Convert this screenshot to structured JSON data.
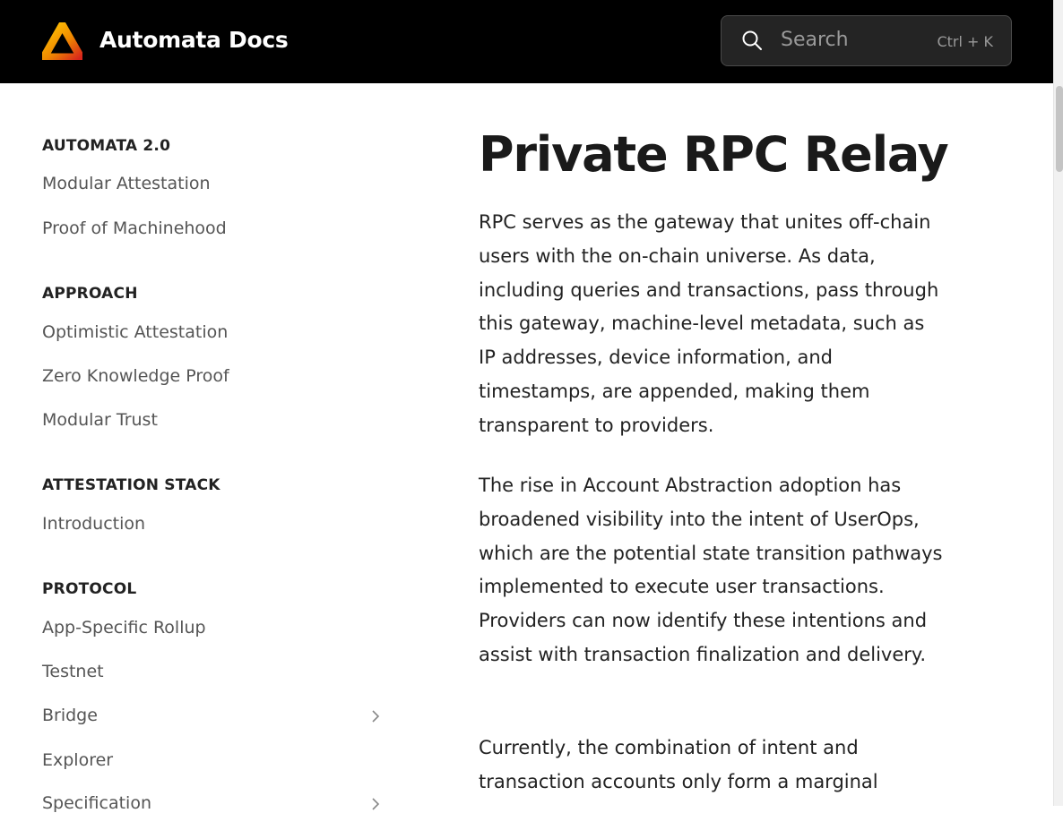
{
  "header": {
    "brand": "Automata Docs",
    "search_placeholder": "Search",
    "search_shortcut": "Ctrl + K"
  },
  "sidebar": {
    "sections": [
      {
        "title": "AUTOMATA 2.0",
        "items": [
          "Modular Attestation",
          "Proof of Machinehood"
        ]
      },
      {
        "title": "APPROACH",
        "items": [
          "Optimistic Attestation",
          "Zero Knowledge Proof",
          "Modular Trust"
        ]
      },
      {
        "title": "ATTESTATION STACK",
        "items": [
          "Introduction"
        ]
      },
      {
        "title": "PROTOCOL",
        "items": [
          "App-Specific Rollup",
          "Testnet",
          "Bridge",
          "Explorer",
          "Specification"
        ]
      }
    ]
  },
  "main": {
    "title": "Private RPC Relay",
    "paragraphs": [
      "RPC serves as the gateway that unites off-chain users with the on-chain universe. As data, including queries and transactions, pass through this gateway, machine-level metadata, such as IP addresses, device information, and timestamps, are appended, making them transparent to providers.",
      "The rise in Account Abstraction adoption has broadened visibility into the intent of UserOps, which are the potential state transition pathways implemented to execute user transactions. Providers can now identify these intentions and assist with transaction finalization and delivery.",
      "Currently, the combination of intent and transaction accounts only form a marginal"
    ]
  },
  "colors": {
    "header_bg": "#000000",
    "text": "#222222",
    "muted": "#555555",
    "logo_gradient": [
      "#f4b000",
      "#e03a1a"
    ]
  }
}
